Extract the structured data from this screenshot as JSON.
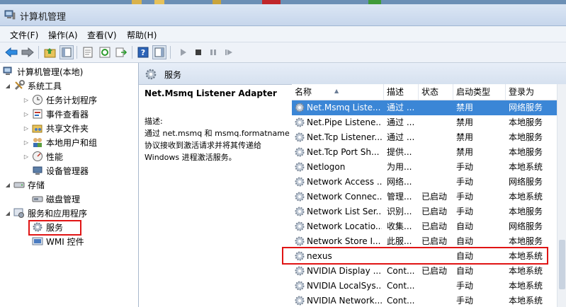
{
  "window": {
    "title": "计算机管理"
  },
  "menu": [
    "文件(F)",
    "操作(A)",
    "查看(V)",
    "帮助(H)"
  ],
  "tree": {
    "root": "计算机管理(本地)",
    "system_tools": "系统工具",
    "task_scheduler": "任务计划程序",
    "event_viewer": "事件查看器",
    "shared_folders": "共享文件夹",
    "local_users": "本地用户和组",
    "performance": "性能",
    "device_manager": "设备管理器",
    "storage": "存储",
    "disk_mgmt": "磁盘管理",
    "services_apps": "服务和应用程序",
    "services": "服务",
    "wmi": "WMI 控件"
  },
  "pane_header": "服务",
  "description": {
    "service_name": "Net.Msmq Listener Adapter",
    "label": "描述:",
    "text": "通过 net.msmq 和 msmq.formatname 协议接收到激活请求并将其传递给 Windows 进程激活服务。"
  },
  "columns": [
    "名称",
    "描述",
    "状态",
    "启动类型",
    "登录为"
  ],
  "services": [
    {
      "name": "Net.Msmq Liste...",
      "desc": "通过 ...",
      "status": "",
      "startup": "禁用",
      "logon": "网络服务",
      "selected": true
    },
    {
      "name": "Net.Pipe Listene...",
      "desc": "通过 ...",
      "status": "",
      "startup": "禁用",
      "logon": "本地服务"
    },
    {
      "name": "Net.Tcp Listener...",
      "desc": "通过 ...",
      "status": "",
      "startup": "禁用",
      "logon": "本地服务"
    },
    {
      "name": "Net.Tcp Port Sh...",
      "desc": "提供...",
      "status": "",
      "startup": "禁用",
      "logon": "本地服务"
    },
    {
      "name": "Netlogon",
      "desc": "为用...",
      "status": "",
      "startup": "手动",
      "logon": "本地系统"
    },
    {
      "name": "Network Access ...",
      "desc": "网络...",
      "status": "",
      "startup": "手动",
      "logon": "网络服务"
    },
    {
      "name": "Network Connec...",
      "desc": "管理...",
      "status": "已启动",
      "startup": "手动",
      "logon": "本地系统"
    },
    {
      "name": "Network List Ser...",
      "desc": "识别...",
      "status": "已启动",
      "startup": "手动",
      "logon": "本地服务"
    },
    {
      "name": "Network Locatio...",
      "desc": "收集...",
      "status": "已启动",
      "startup": "自动",
      "logon": "网络服务"
    },
    {
      "name": "Network Store I...",
      "desc": "此服...",
      "status": "已启动",
      "startup": "自动",
      "logon": "本地服务"
    },
    {
      "name": "nexus",
      "desc": "",
      "status": "",
      "startup": "自动",
      "logon": "本地系统"
    },
    {
      "name": "NVIDIA Display ...",
      "desc": "Cont...",
      "status": "已启动",
      "startup": "自动",
      "logon": "本地系统"
    },
    {
      "name": "NVIDIA LocalSys...",
      "desc": "Cont...",
      "status": "",
      "startup": "手动",
      "logon": "本地系统"
    },
    {
      "name": "NVIDIA Network...",
      "desc": "Cont...",
      "status": "",
      "startup": "手动",
      "logon": "本地系统"
    }
  ],
  "colors": {
    "selection": "#3b86d6",
    "highlight_box": "#e01414"
  }
}
